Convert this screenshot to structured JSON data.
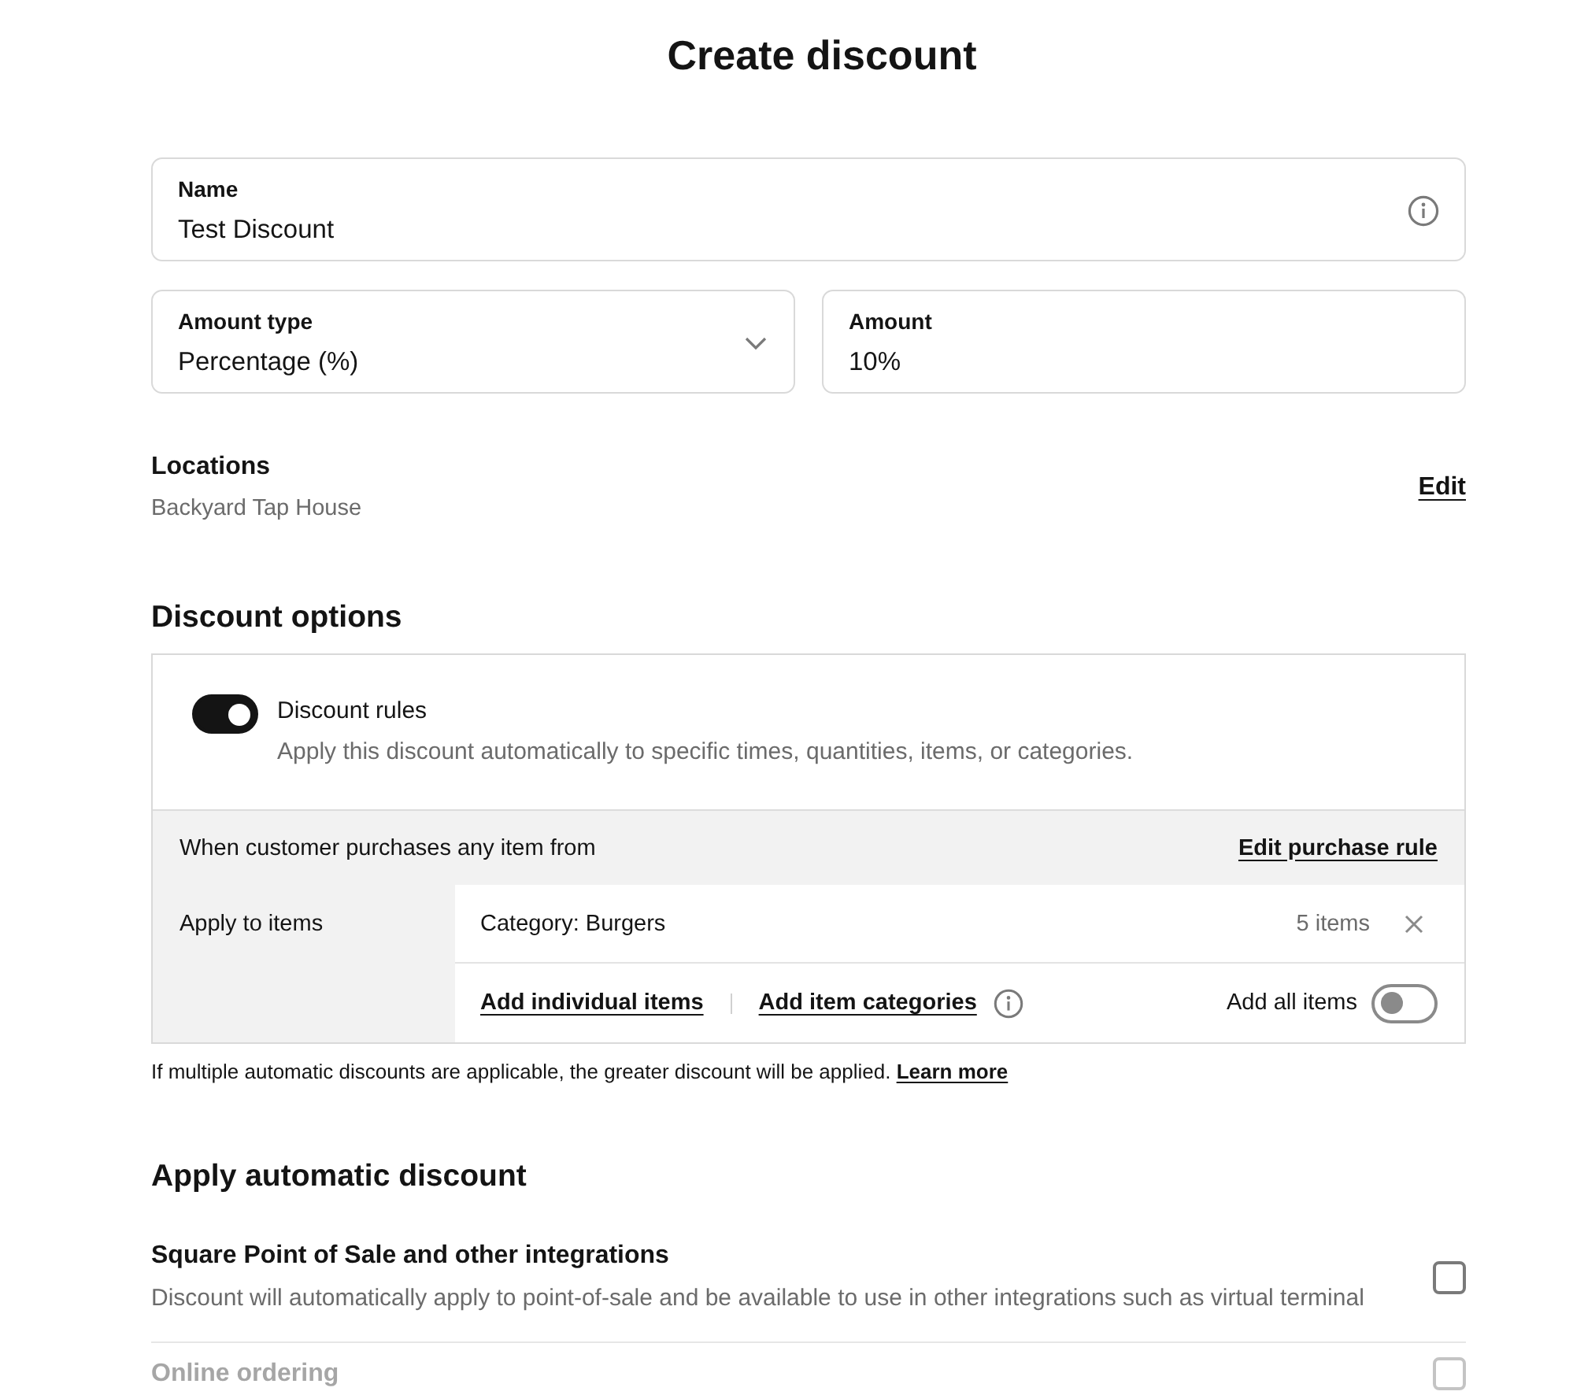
{
  "title": "Create discount",
  "name_field": {
    "label": "Name",
    "value": "Test Discount"
  },
  "amount_type_field": {
    "label": "Amount type",
    "value": "Percentage (%)"
  },
  "amount_field": {
    "label": "Amount",
    "value": "10%"
  },
  "locations": {
    "label": "Locations",
    "value": "Backyard Tap House",
    "edit_link": "Edit"
  },
  "discount_options": {
    "heading": "Discount options",
    "rules": {
      "title": "Discount rules",
      "description": "Apply this discount automatically to specific times, quantities, items, or categories.",
      "on": true
    },
    "purchase_rule": {
      "label": "When customer purchases any item from",
      "edit_link": "Edit purchase rule"
    },
    "apply_to": {
      "label": "Apply to items",
      "items": [
        {
          "name": "Category: Burgers",
          "count": "5 items"
        }
      ],
      "add_individual_link": "Add individual items",
      "add_categories_link": "Add item categories",
      "add_all": {
        "label": "Add all items",
        "on": false
      }
    },
    "footnote": "If multiple automatic discounts are applicable, the greater discount will be applied.",
    "footnote_link": "Learn more"
  },
  "apply_automatic": {
    "heading": "Apply automatic discount",
    "options": [
      {
        "title": "Square Point of Sale and other integrations",
        "description": "Discount will automatically apply to point-of-sale and be available to use in other integrations such as virtual terminal",
        "checked": false,
        "disabled": false
      },
      {
        "title": "Online ordering",
        "checked": false,
        "disabled": true
      }
    ]
  }
}
